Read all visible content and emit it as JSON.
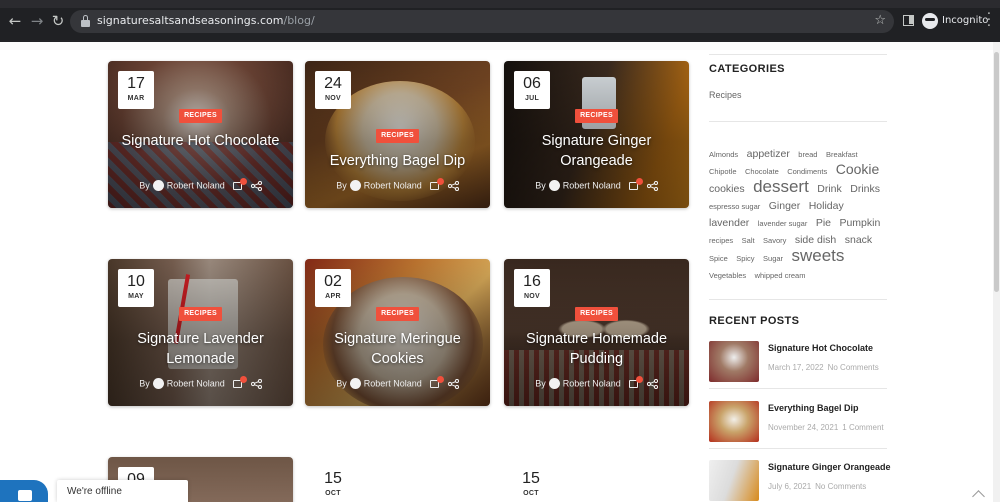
{
  "browser": {
    "url_domain": "signaturesaltsandseasonings.com",
    "url_path": "/blog/",
    "profile_label": "Incognito"
  },
  "posts": [
    {
      "day": "17",
      "month": "MAR",
      "category": "RECIPES",
      "title": "Signature Hot Chocolate",
      "by": "By",
      "author": "Robert Noland"
    },
    {
      "day": "24",
      "month": "NOV",
      "category": "RECIPES",
      "title": "Everything Bagel Dip",
      "by": "By",
      "author": "Robert Noland"
    },
    {
      "day": "06",
      "month": "JUL",
      "category": "RECIPES",
      "title": "Signature Ginger Orangeade",
      "by": "By",
      "author": "Robert Noland"
    },
    {
      "day": "10",
      "month": "MAY",
      "category": "RECIPES",
      "title": "Signature Lavender Lemonade",
      "by": "By",
      "author": "Robert Noland"
    },
    {
      "day": "02",
      "month": "APR",
      "category": "RECIPES",
      "title": "Signature Meringue Cookies",
      "by": "By",
      "author": "Robert Noland"
    },
    {
      "day": "16",
      "month": "NOV",
      "category": "RECIPES",
      "title": "Signature Homemade Pudding",
      "by": "By",
      "author": "Robert Noland"
    },
    {
      "day": "09",
      "month": ""
    },
    {
      "day": "15",
      "month": "OCT"
    },
    {
      "day": "15",
      "month": "OCT"
    }
  ],
  "sidebar": {
    "categories_heading": "CATEGORIES",
    "categories": [
      "Recipes"
    ],
    "tags": [
      {
        "label": "Almonds",
        "size": "small"
      },
      {
        "label": "appetizer",
        "size": "medium"
      },
      {
        "label": "bread",
        "size": "small"
      },
      {
        "label": "Breakfast",
        "size": "small"
      },
      {
        "label": "Chipotle",
        "size": "small"
      },
      {
        "label": "Chocolate",
        "size": "small"
      },
      {
        "label": "Condiments",
        "size": "small"
      },
      {
        "label": "Cookie",
        "size": "large"
      },
      {
        "label": "cookies",
        "size": "medium"
      },
      {
        "label": "dessert",
        "size": "xlarge"
      },
      {
        "label": "Drink",
        "size": "medium"
      },
      {
        "label": "Drinks",
        "size": "medium"
      },
      {
        "label": "espresso sugar",
        "size": "small"
      },
      {
        "label": "Ginger",
        "size": "medium"
      },
      {
        "label": "Holiday",
        "size": "medium"
      },
      {
        "label": "lavender",
        "size": "medium"
      },
      {
        "label": "lavender sugar",
        "size": "small"
      },
      {
        "label": "Pie",
        "size": "medium"
      },
      {
        "label": "Pumpkin",
        "size": "medium"
      },
      {
        "label": "recipes",
        "size": "small"
      },
      {
        "label": "Salt",
        "size": "small"
      },
      {
        "label": "Savory",
        "size": "small"
      },
      {
        "label": "side dish",
        "size": "medium"
      },
      {
        "label": "snack",
        "size": "medium"
      },
      {
        "label": "Spice",
        "size": "small"
      },
      {
        "label": "Spicy",
        "size": "small"
      },
      {
        "label": "Sugar",
        "size": "small"
      },
      {
        "label": "sweets",
        "size": "xlarge"
      },
      {
        "label": "Vegetables",
        "size": "small"
      },
      {
        "label": "whipped cream",
        "size": "small"
      }
    ],
    "recent_heading": "RECENT POSTS",
    "recent_posts": [
      {
        "title": "Signature Hot Chocolate",
        "date": "March 17, 2022",
        "comments": "No Comments"
      },
      {
        "title": "Everything Bagel Dip",
        "date": "November 24, 2021",
        "comments": "1 Comment"
      },
      {
        "title": "Signature Ginger Orangeade",
        "date": "July 6, 2021",
        "comments": "No Comments"
      }
    ]
  },
  "chat": {
    "status": "We're offline"
  },
  "colors": {
    "accent": "#f0503c",
    "chat_blue": "#1e73be"
  }
}
